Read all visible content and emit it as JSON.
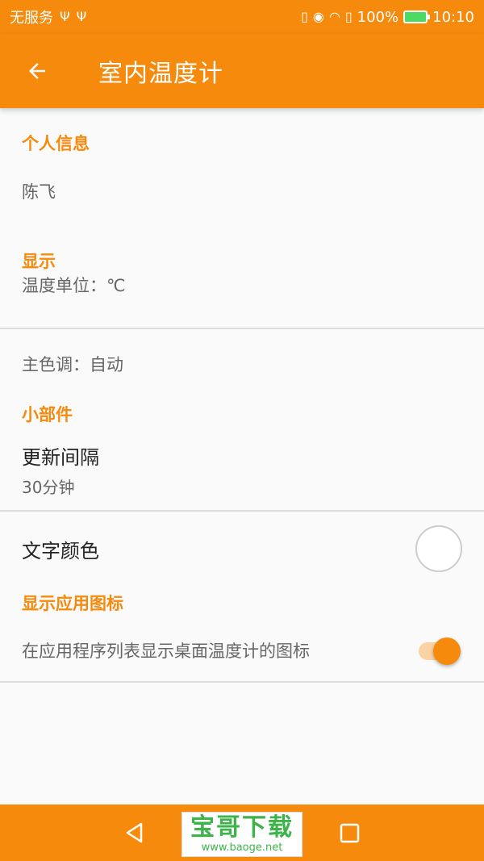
{
  "status_bar": {
    "carrier": "无服务",
    "usb_icons": [
      "usb-icon",
      "usb-icon"
    ],
    "right_icons": [
      "vibrate-icon",
      "eye-icon",
      "wifi-icon",
      "sim-icon"
    ],
    "battery_text": "100%",
    "time": "10:10"
  },
  "app_bar": {
    "back_icon": "arrow-back-icon",
    "title": "室内温度计"
  },
  "sections": {
    "personal": {
      "header": "个人信息",
      "name": "陈飞"
    },
    "display": {
      "header": "显示",
      "temp_unit": "温度单位：℃",
      "theme": "主色调：自动"
    },
    "widget": {
      "header": "小部件",
      "update_title": "更新间隔",
      "update_summary": "30分钟",
      "text_color_title": "文字颜色"
    },
    "app_icon": {
      "header": "显示应用图标",
      "toggle_label": "在应用程序列表显示桌面温度计的图标",
      "toggle_on": true
    }
  },
  "nav_bar": {
    "back": "nav-back-icon",
    "home": "nav-home-icon",
    "recent": "nav-recent-icon"
  },
  "watermark": {
    "text": "宝哥下载",
    "url": "www.baoge.net"
  },
  "colors": {
    "accent": "#f68a0c",
    "toggle_track": "#fbd2a3",
    "watermark": "#3db34a"
  }
}
